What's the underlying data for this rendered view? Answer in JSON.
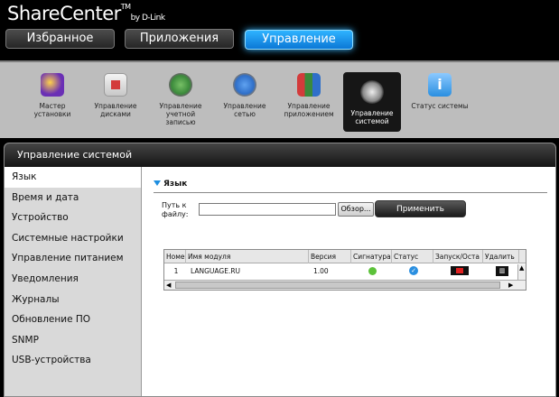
{
  "app": {
    "brand": "ShareCenter",
    "brand_tm": "TM",
    "brand_by": "by D-Link"
  },
  "tabs": [
    {
      "label": "Избранное",
      "active": false
    },
    {
      "label": "Приложения",
      "active": false
    },
    {
      "label": "Управление",
      "active": true
    }
  ],
  "toolbar": [
    {
      "label": "Мастер установки",
      "icon": "wizard-icon",
      "color": "#6a2fb5"
    },
    {
      "label": "Управление дисками",
      "icon": "disk-management-icon",
      "color": "#d33b3b"
    },
    {
      "label": "Управление учетной записью",
      "icon": "account-management-icon",
      "color": "#3b8a3b"
    },
    {
      "label": "Управление сетью",
      "icon": "network-management-icon",
      "color": "#2f6fc9"
    },
    {
      "label": "Управление приложением",
      "icon": "application-management-icon",
      "color": "#e0a020"
    },
    {
      "label": "Управление системой",
      "icon": "system-management-icon",
      "color": "#555555",
      "selected": true
    },
    {
      "label": "Статус системы",
      "icon": "system-status-icon",
      "color": "#2a8fe0"
    }
  ],
  "panel": {
    "title": "Управление системой"
  },
  "sidebar": {
    "items": [
      {
        "label": "Язык",
        "active": true
      },
      {
        "label": "Время и дата"
      },
      {
        "label": "Устройство"
      },
      {
        "label": "Системные настройки"
      },
      {
        "label": "Управление питанием"
      },
      {
        "label": "Уведомления"
      },
      {
        "label": "Журналы"
      },
      {
        "label": "Обновление ПО"
      },
      {
        "label": "SNMP"
      },
      {
        "label": "USB-устройства"
      }
    ]
  },
  "language_section": {
    "title": "Язык",
    "path_label": "Путь к файлу:",
    "path_value": "",
    "browse_button": "Обзор...",
    "apply_button": "Применить"
  },
  "grid": {
    "columns": [
      "Номе",
      "Имя модуля",
      "Версия",
      "Сигнатура",
      "Статус",
      "Запуск/Оста",
      "Удалить"
    ],
    "rows": [
      {
        "num": "1",
        "name": "LANGUAGE.RU",
        "version": "1.00"
      }
    ]
  }
}
